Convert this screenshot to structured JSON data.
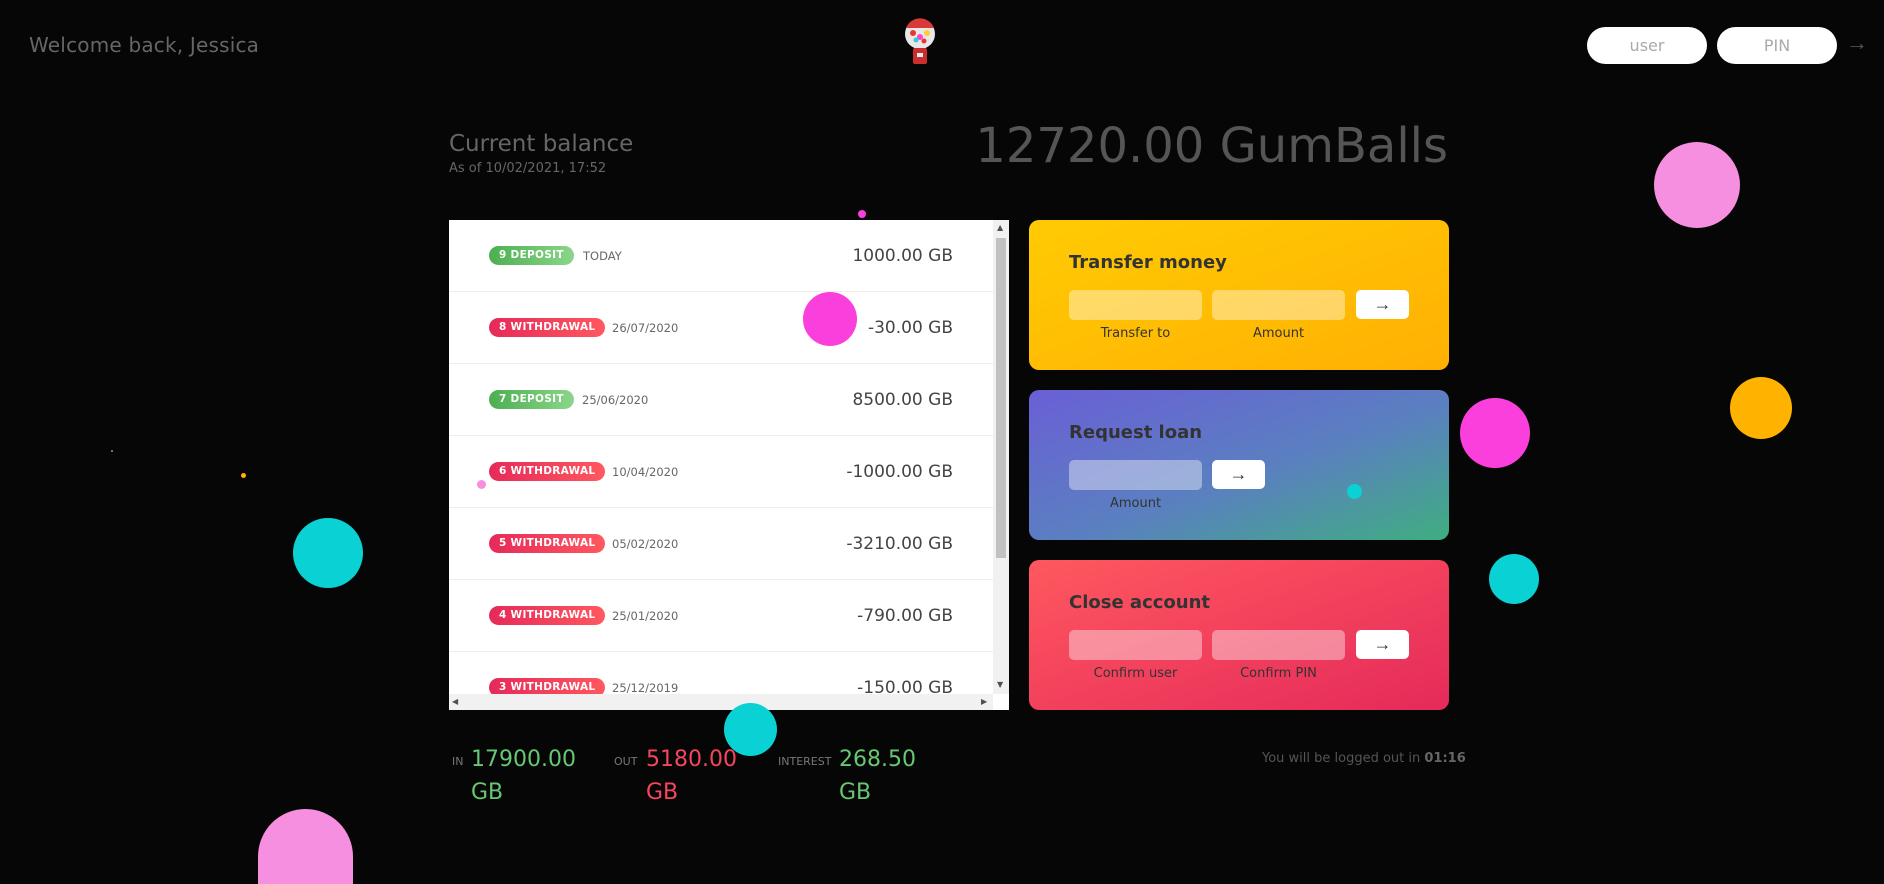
{
  "header": {
    "welcome": "Welcome back, Jessica",
    "user_placeholder": "user",
    "pin_placeholder": "PIN",
    "login_arrow": "→"
  },
  "balance": {
    "label": "Current balance",
    "date": "As of 10/02/2021, 17:52",
    "value": "12720.00 GumBalls"
  },
  "movements": [
    {
      "type": "9 DEPOSIT",
      "kind": "deposit",
      "date": "TODAY",
      "value": "1000.00 GB"
    },
    {
      "type": "8 WITHDRAWAL",
      "kind": "withdrawal",
      "date": "26/07/2020",
      "value": "-30.00 GB"
    },
    {
      "type": "7 DEPOSIT",
      "kind": "deposit",
      "date": "25/06/2020",
      "value": "8500.00 GB"
    },
    {
      "type": "6 WITHDRAWAL",
      "kind": "withdrawal",
      "date": "10/04/2020",
      "value": "-1000.00 GB"
    },
    {
      "type": "5 WITHDRAWAL",
      "kind": "withdrawal",
      "date": "05/02/2020",
      "value": "-3210.00 GB"
    },
    {
      "type": "4 WITHDRAWAL",
      "kind": "withdrawal",
      "date": "25/01/2020",
      "value": "-790.00 GB"
    },
    {
      "type": "3 WITHDRAWAL",
      "kind": "withdrawal",
      "date": "25/12/2019",
      "value": "-150.00 GB"
    }
  ],
  "operations": {
    "transfer": {
      "title": "Transfer money",
      "label_to": "Transfer to",
      "label_amount": "Amount",
      "button": "→"
    },
    "loan": {
      "title": "Request loan",
      "label_amount": "Amount",
      "button": "→"
    },
    "close": {
      "title": "Close account",
      "label_user": "Confirm user",
      "label_pin": "Confirm PIN",
      "button": "→"
    }
  },
  "summary": {
    "in_label": "IN",
    "in_value": "17900.00 GB",
    "out_label": "OUT",
    "out_value": "5180.00 GB",
    "interest_label": "INTEREST",
    "interest_value": "268.50 GB"
  },
  "logout": {
    "text": "You will be logged out in ",
    "time": "01:16"
  },
  "colors": {
    "deposit": "#66c873",
    "withdrawal": "#f5465d",
    "transfer_card": "#ffb003",
    "close_card": "#ff585f",
    "bubble_pink": "#f68fe0",
    "bubble_magenta": "#fb3fdc",
    "bubble_cyan": "#0ad2d4",
    "bubble_yellow": "#ffb300"
  }
}
